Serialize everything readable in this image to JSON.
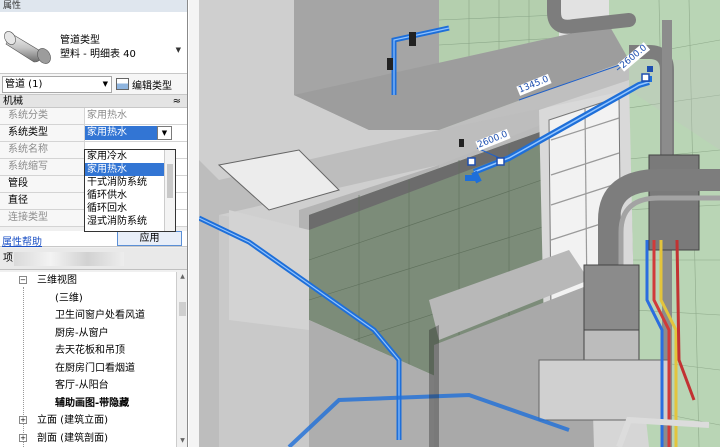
{
  "properties": {
    "title": "属性",
    "type_name_line1": "管道类型",
    "type_name_line2": "塑料 - 明细表 40",
    "instance_selector": "管道 (1)",
    "edit_type_label": "编辑类型",
    "category": "机械",
    "rows": [
      {
        "key": "系统分类",
        "value": "家用热水",
        "muted": true
      },
      {
        "key": "系统类型",
        "value": "家用热水",
        "muted": false
      },
      {
        "key": "系统名称",
        "value": "",
        "muted": true
      },
      {
        "key": "系统缩写",
        "value": "",
        "muted": true
      },
      {
        "key": "管段",
        "value": "",
        "muted": false
      },
      {
        "key": "直径",
        "value": "",
        "muted": false
      },
      {
        "key": "连接类型",
        "value": "",
        "muted": true
      }
    ],
    "dropdown_options": [
      "家用冷水",
      "家用热水",
      "干式消防系统",
      "循环供水",
      "循环回水",
      "湿式消防系统"
    ],
    "dropdown_selected_index": 1,
    "help_link": "属性帮助",
    "apply_label": "应用"
  },
  "browser": {
    "header_label": "项",
    "items": [
      {
        "label": "三维视图",
        "expander": "−",
        "indent": 1
      },
      {
        "label": "(三维)",
        "indent": 2
      },
      {
        "label": "卫生间窗户处看风道",
        "indent": 2
      },
      {
        "label": "厨房-从窗户",
        "indent": 2
      },
      {
        "label": "去天花板和吊顶",
        "indent": 2
      },
      {
        "label": "在厨房门口看烟道",
        "indent": 2
      },
      {
        "label": "客厅-从阳台",
        "indent": 2
      },
      {
        "label": "辅助画图-带隐藏",
        "indent": 2,
        "bold": true
      },
      {
        "label": "立面 (建筑立面)",
        "expander": "+",
        "indent": 1
      },
      {
        "label": "剖面 (建筑剖面)",
        "expander": "+",
        "indent": 1
      }
    ]
  },
  "viewport": {
    "dimensions": [
      "2600.0",
      "1345.0",
      "2600.0"
    ],
    "colors": {
      "pipe": "#1e6fd9",
      "wall_top": "#a9a9a9",
      "wall_face": "#8a8a8a",
      "tile": "#b7d2b3",
      "gray_pipe": "#7d7d7d"
    }
  }
}
